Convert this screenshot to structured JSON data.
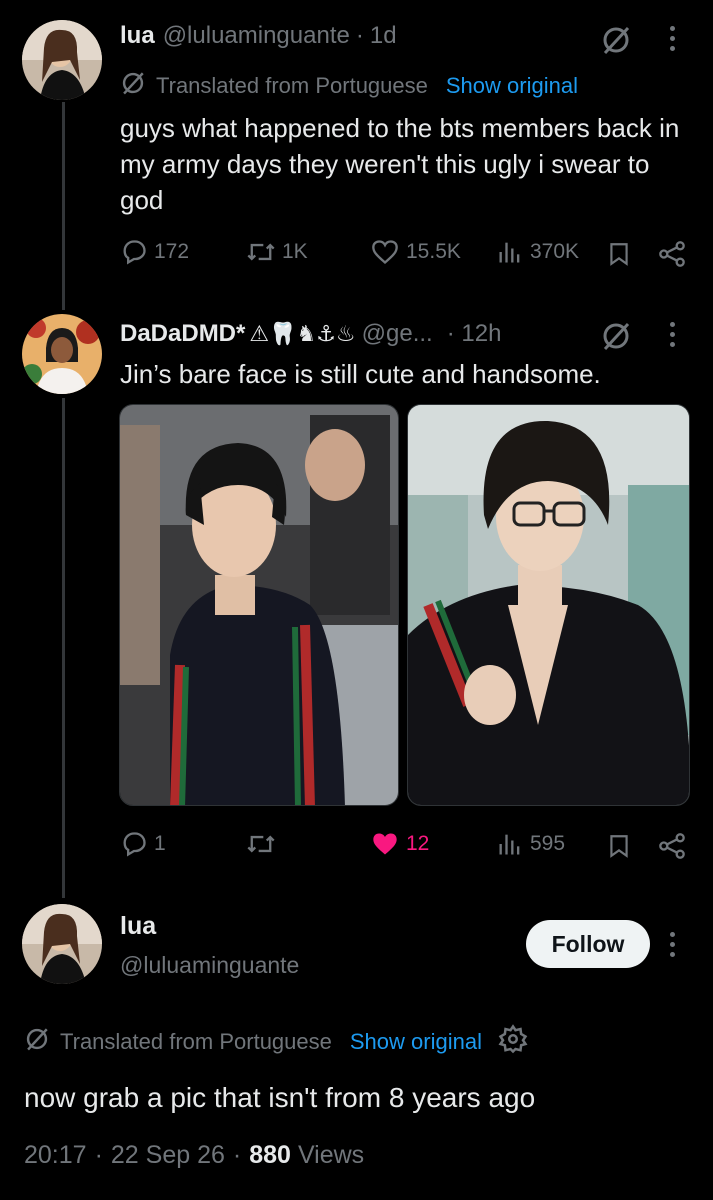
{
  "tweet1": {
    "name": "lua",
    "handle": "@luluaminguante",
    "separator": "·",
    "time": "1d",
    "translated_label": "Translated from Portuguese",
    "show_original": "Show original",
    "text": "guys what happened to the bts members back in my army days they weren't this ugly i swear to god",
    "replies": "172",
    "reposts": "1K",
    "likes": "15.5K",
    "views": "370K"
  },
  "tweet2": {
    "name": "DaDaDMD*",
    "emojis": "⚠🦷♞⚓♨",
    "handle": "@ge...",
    "time": "· 12h",
    "text": "Jin’s bare face is still cute and handsome.",
    "replies": "1",
    "reposts": "",
    "likes": "12",
    "views": "595",
    "like_color": "#f91880"
  },
  "main_tweet": {
    "name": "lua",
    "handle": "@luluaminguante",
    "follow_label": "Follow",
    "translated_label": "Translated from Portuguese",
    "show_original": "Show original",
    "text": "now grab a pic that isn't from 8 years ago",
    "timestamp": "20:17",
    "date": "22 Sep 26",
    "views_count": "880",
    "views_label": "Views"
  },
  "icons": [
    "grok-icon",
    "more-icon",
    "reply-icon",
    "repost-icon",
    "like-icon",
    "views-icon",
    "bookmark-icon",
    "share-icon",
    "settings-icon"
  ],
  "colors": {
    "background": "#000000",
    "text": "#e7e9ea",
    "muted": "#71767b",
    "link": "#1d9bf0",
    "like_active": "#f91880"
  }
}
